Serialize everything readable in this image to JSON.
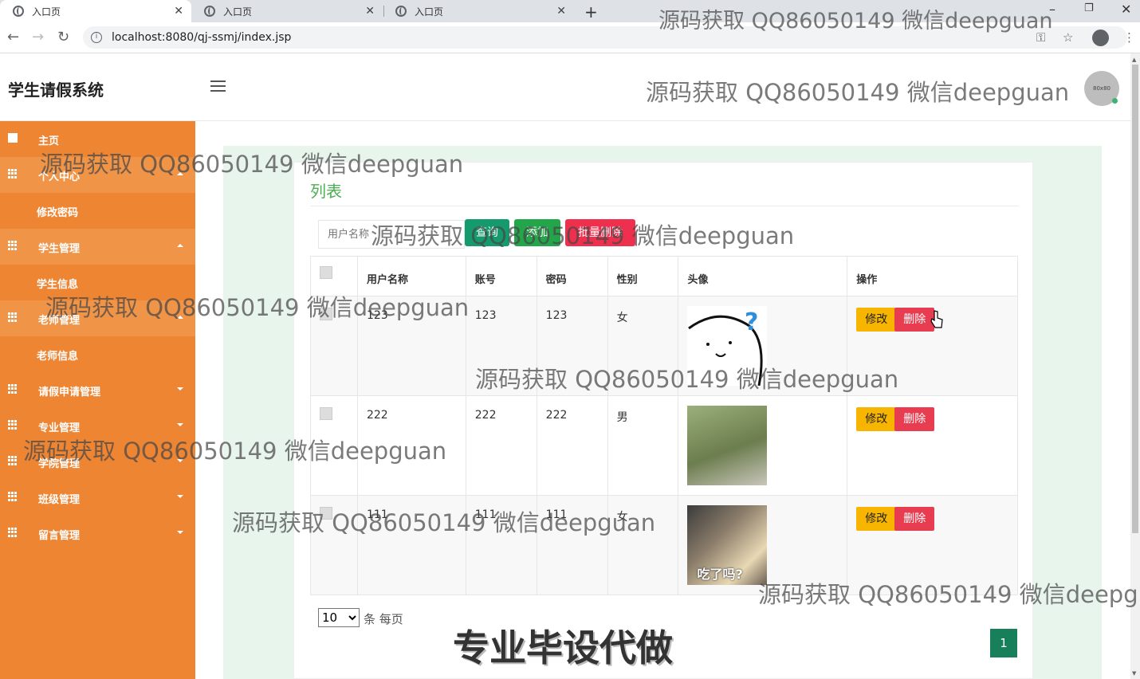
{
  "browser": {
    "tabs": [
      {
        "title": "入口页",
        "active": true
      },
      {
        "title": "入口页",
        "active": false
      },
      {
        "title": "入口页",
        "active": false
      }
    ],
    "url": "localhost:8080/qj-ssmj/index.jsp"
  },
  "header": {
    "brand": "学生请假系统",
    "avatar_text": "80x80"
  },
  "sidebar": {
    "items": [
      {
        "label": "主页",
        "icon": "flag-icon"
      },
      {
        "label": "个人中心",
        "icon": "grid-icon",
        "expanded": true
      },
      {
        "label": "修改密码",
        "sub": true
      },
      {
        "label": "学生管理",
        "icon": "grid-icon",
        "expanded": true
      },
      {
        "label": "学生信息",
        "sub": true
      },
      {
        "label": "老师管理",
        "icon": "grid-icon",
        "expanded": true
      },
      {
        "label": "老师信息",
        "sub": true
      },
      {
        "label": "请假申请管理",
        "icon": "grid-icon"
      },
      {
        "label": "专业管理",
        "icon": "grid-icon"
      },
      {
        "label": "学院管理",
        "icon": "grid-icon"
      },
      {
        "label": "班级管理",
        "icon": "grid-icon"
      },
      {
        "label": "留言管理",
        "icon": "grid-icon"
      }
    ]
  },
  "main": {
    "title": "列表",
    "search_placeholder": "用户名称",
    "buttons": {
      "query": "查询",
      "add": "添加",
      "batch_delete": "批量删除"
    },
    "columns": [
      "用户名称",
      "账号",
      "密码",
      "性别",
      "头像",
      "操作"
    ],
    "rows": [
      {
        "username": "123",
        "account": "123",
        "password": "123",
        "gender": "女",
        "avatar": "question-face",
        "avatar_caption": ""
      },
      {
        "username": "222",
        "account": "222",
        "password": "222",
        "gender": "男",
        "avatar": "green-sleeve",
        "avatar_caption": ""
      },
      {
        "username": "111",
        "account": "111",
        "password": "111",
        "gender": "女",
        "avatar": "eating-boy",
        "avatar_caption": "吃了吗?"
      }
    ],
    "row_actions": {
      "edit": "修改",
      "delete": "删除"
    },
    "page_size": "10",
    "page_size_label": "条 每页",
    "current_page": "1"
  },
  "overlay": {
    "watermark": "源码获取 QQ86050149 微信deepguan",
    "promo": "专业毕设代做"
  },
  "colors": {
    "sidebar": "#ee8533",
    "query": "#159a6d",
    "add": "#23a64a",
    "danger": "#ee2f4e",
    "edit": "#f7b500",
    "pager": "#17805a",
    "title": "#4caf50"
  }
}
